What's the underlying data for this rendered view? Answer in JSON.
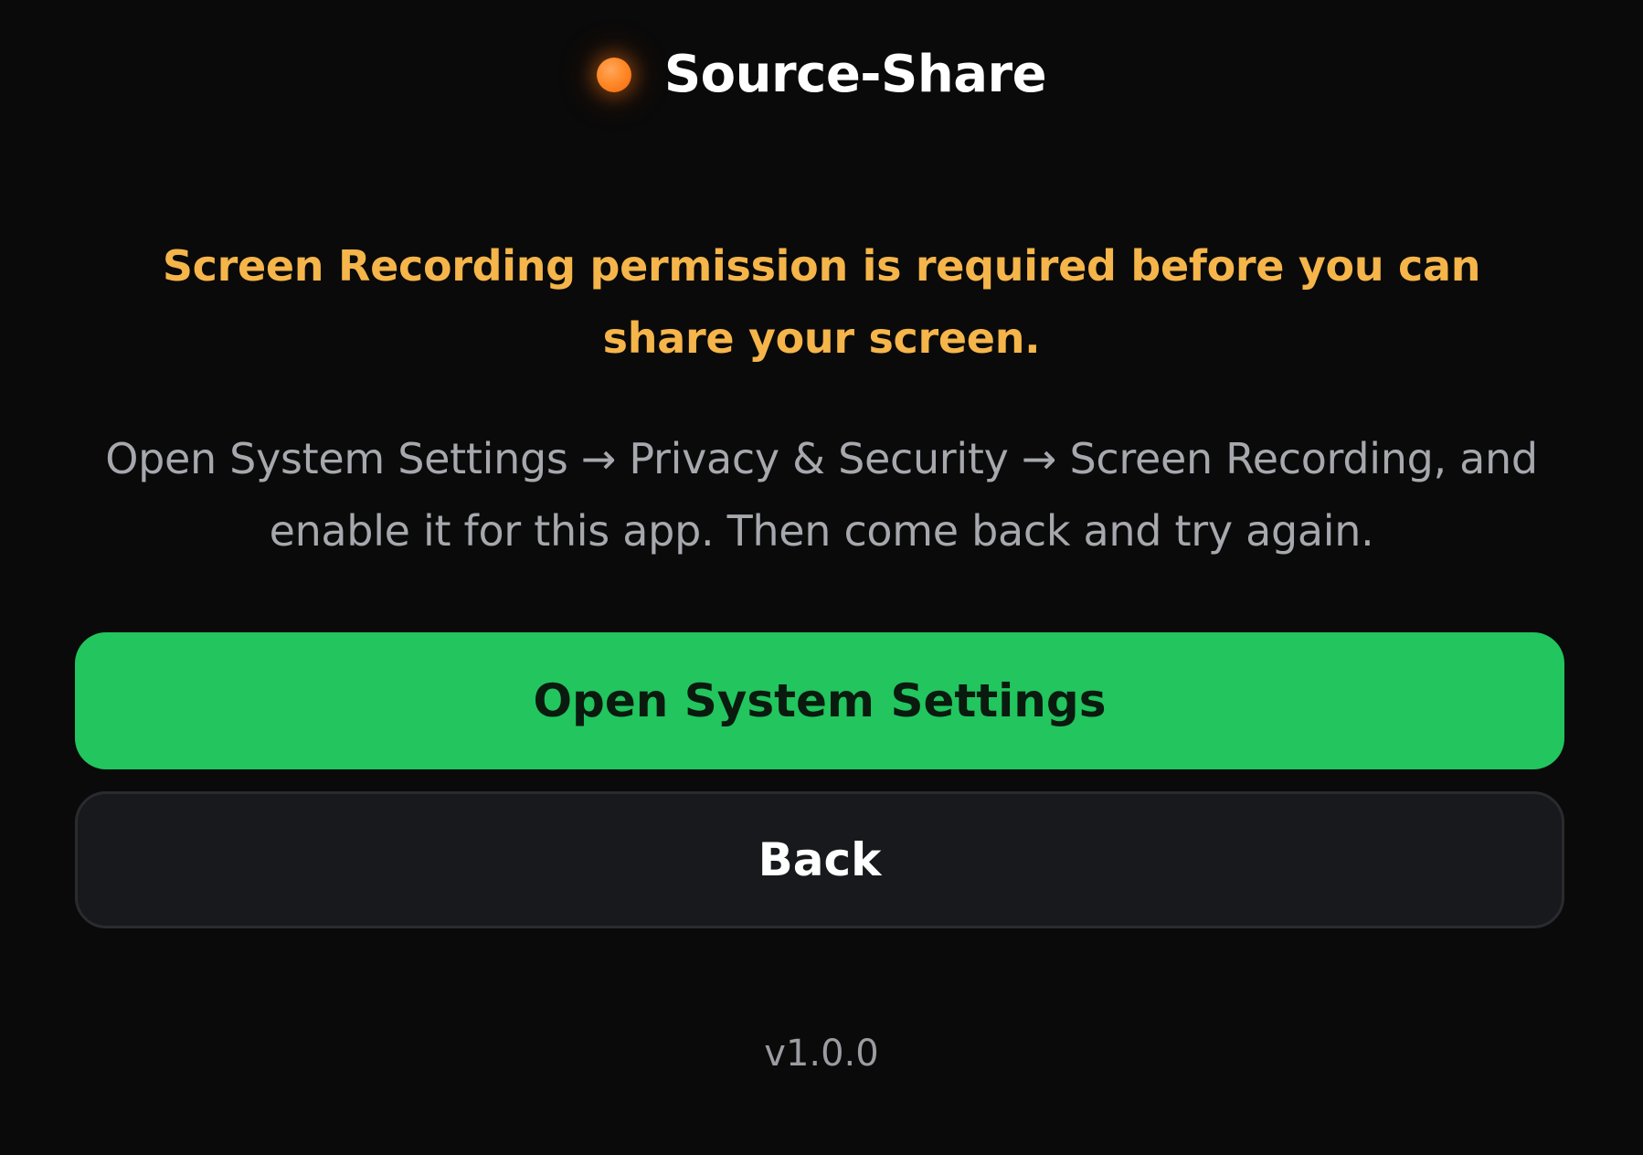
{
  "header": {
    "app_name": "Source-Share",
    "status_indicator": "orange-dot-icon"
  },
  "permission": {
    "warning_text": "Screen Recording permission is required before you can share your screen.",
    "instructions_text": "Open System Settings → Privacy & Security → Screen Recording, and enable it for this app. Then come back and try again."
  },
  "actions": {
    "open_settings_label": "Open System Settings",
    "back_label": "Back"
  },
  "footer": {
    "version": "v1.0.0"
  },
  "colors": {
    "background": "#0a0a0a",
    "accent_green": "#22c55e",
    "warning_amber": "#f5b54a",
    "status_orange": "#ff8a2a",
    "muted_text": "#a6a8ad"
  }
}
